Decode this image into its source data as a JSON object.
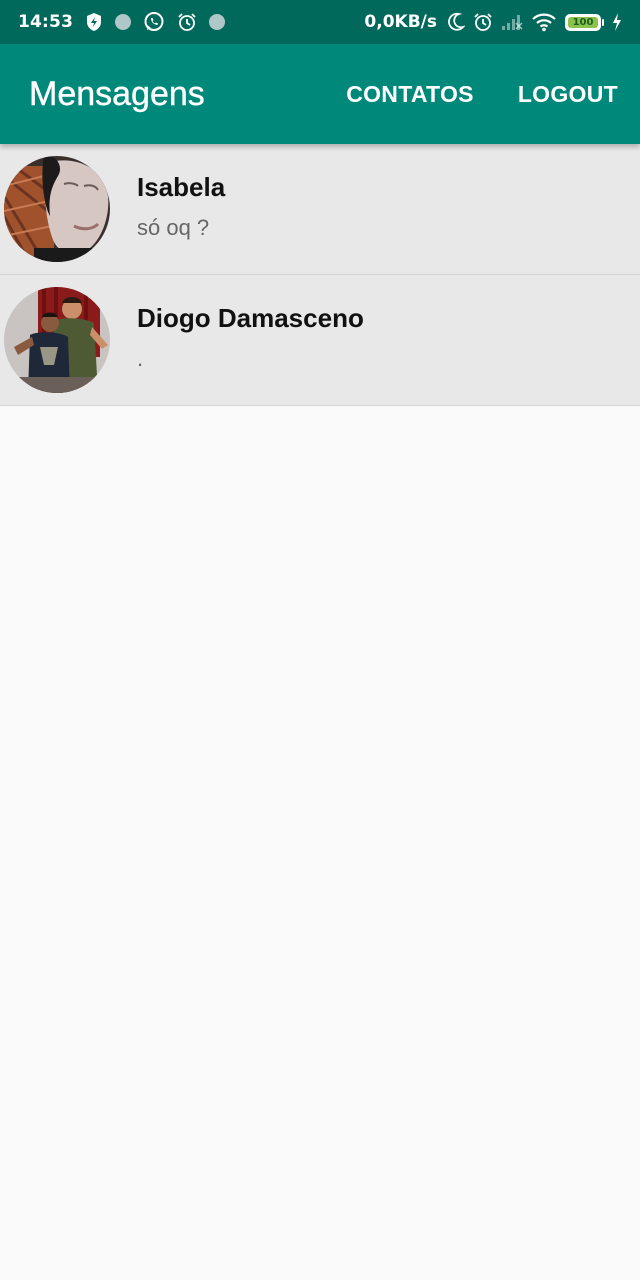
{
  "status_bar": {
    "time": "14:53",
    "network_speed": "0,0KB/s",
    "battery_level": "100",
    "left_icons": [
      "shield-bolt-icon",
      "notification-dot-icon",
      "whatsapp-icon",
      "alarm-icon",
      "notification-dot-icon"
    ],
    "right_icons": [
      "moon-icon",
      "alarm-icon",
      "signal-icon",
      "wifi-icon",
      "battery-icon",
      "charging-icon"
    ]
  },
  "app_bar": {
    "title": "Mensagens",
    "contacts_label": "CONTATOS",
    "logout_label": "LOGOUT"
  },
  "conversations": [
    {
      "name": "Isabela",
      "last_message": "só oq  ?"
    },
    {
      "name": "Diogo Damasceno",
      "last_message": "."
    }
  ],
  "colors": {
    "status_bar": "#00695c",
    "app_bar": "#00897b",
    "list_item_background": "#e8e8e8",
    "page_background": "#fafafa"
  }
}
